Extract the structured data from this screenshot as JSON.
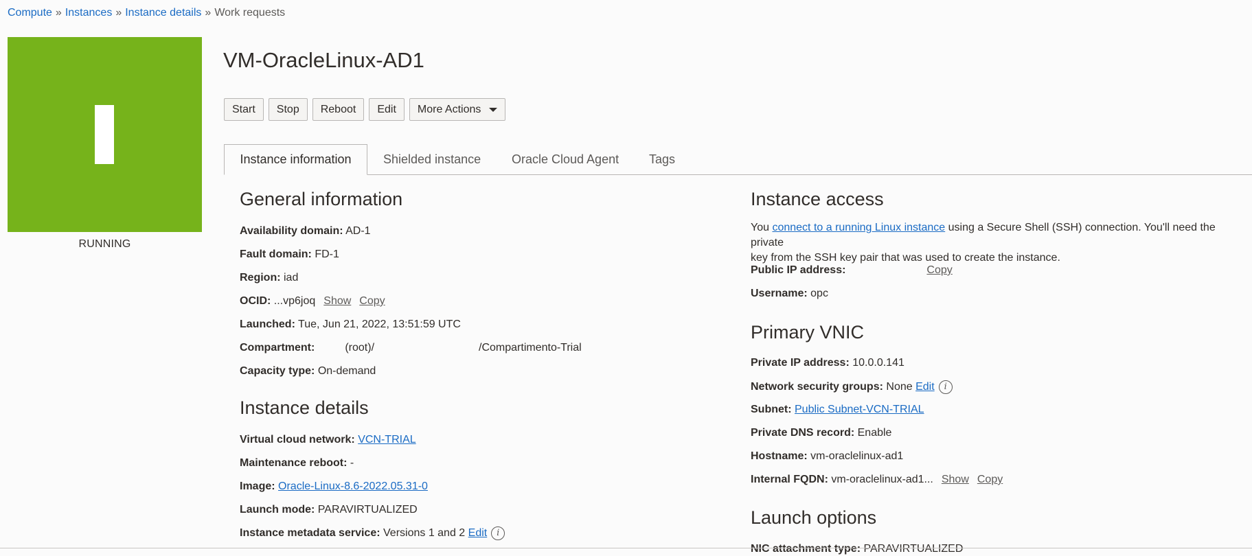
{
  "breadcrumb": {
    "items": [
      "Compute",
      "Instances",
      "Instance details"
    ],
    "current": "Work requests",
    "separator": "»"
  },
  "status": {
    "label": "RUNNING",
    "color": "#76b31b",
    "letter": "I"
  },
  "page_title": "VM-OracleLinux-AD1",
  "toolbar": {
    "start": "Start",
    "stop": "Stop",
    "reboot": "Reboot",
    "edit": "Edit",
    "more_actions": "More Actions"
  },
  "tabs": [
    "Instance information",
    "Shielded instance",
    "Oracle Cloud Agent",
    "Tags"
  ],
  "general": {
    "title": "General information",
    "availability_domain": {
      "label": "Availability domain:",
      "value": "AD-1"
    },
    "fault_domain": {
      "label": "Fault domain:",
      "value": "FD-1"
    },
    "region": {
      "label": "Region:",
      "value": "iad"
    },
    "ocid": {
      "label": "OCID:",
      "value": "...vp6joq",
      "show": "Show",
      "copy": "Copy"
    },
    "launched": {
      "label": "Launched:",
      "value": "Tue, Jun 21, 2022, 13:51:59 UTC"
    },
    "compartment": {
      "label": "Compartment:",
      "value_root": "(root)/",
      "value_end": "/Compartimento-Trial"
    },
    "capacity_type": {
      "label": "Capacity type:",
      "value": "On-demand"
    }
  },
  "details": {
    "title": "Instance details",
    "vcn": {
      "label": "Virtual cloud network:",
      "value": "VCN-TRIAL"
    },
    "maintenance": {
      "label": "Maintenance reboot:",
      "value": "-"
    },
    "image": {
      "label": "Image:",
      "value": "Oracle-Linux-8.6-2022.05.31-0"
    },
    "launch_mode": {
      "label": "Launch mode:",
      "value": "PARAVIRTUALIZED"
    },
    "metadata": {
      "label": "Instance metadata service:",
      "value": "Versions 1 and 2",
      "edit": "Edit"
    }
  },
  "access": {
    "title": "Instance access",
    "text_before": "You ",
    "link": "connect to a running Linux instance",
    "text_after": " using a Secure Shell (SSH) connection. You'll need the private",
    "text_line2": "key from the SSH key pair that was used to create the instance.",
    "public_ip": {
      "label": "Public IP address:",
      "copy": "Copy"
    },
    "username": {
      "label": "Username:",
      "value": "opc"
    }
  },
  "vnic": {
    "title": "Primary VNIC",
    "private_ip": {
      "label": "Private IP address:",
      "value": "10.0.0.141"
    },
    "nsg": {
      "label": "Network security groups:",
      "value": "None",
      "edit": "Edit"
    },
    "subnet": {
      "label": "Subnet:",
      "value": "Public Subnet-VCN-TRIAL"
    },
    "dns": {
      "label": "Private DNS record:",
      "value": "Enable"
    },
    "hostname": {
      "label": "Hostname:",
      "value": "vm-oraclelinux-ad1"
    },
    "fqdn": {
      "label": "Internal FQDN:",
      "value": "vm-oraclelinux-ad1...",
      "show": "Show",
      "copy": "Copy"
    }
  },
  "launch_options": {
    "title": "Launch options",
    "nic_type": {
      "label": "NIC attachment type:",
      "value": "PARAVIRTUALIZED"
    }
  }
}
